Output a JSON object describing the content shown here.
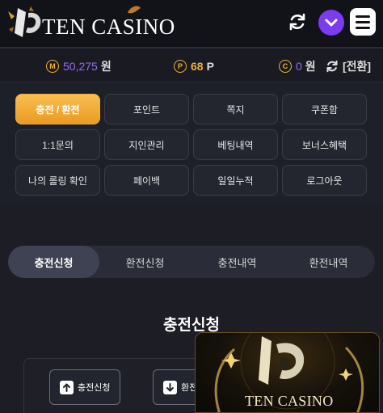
{
  "header": {
    "logo_text": "TEN CASINO",
    "refresh_icon": "refresh-icon",
    "dropdown_icon": "chevron-down-icon",
    "menu_icon": "hamburger-menu-icon",
    "accent": "#7b3bf0"
  },
  "balance": {
    "money": {
      "badge": "M",
      "value": "50,275",
      "unit": "원"
    },
    "point": {
      "badge": "P",
      "value": "68",
      "unit": "P"
    },
    "casino": {
      "badge": "C",
      "value": "0",
      "unit": "원"
    },
    "convert_label": "[전환]"
  },
  "menu": {
    "items": [
      {
        "label": "충전 / 환전",
        "active": true
      },
      {
        "label": "포인트"
      },
      {
        "label": "쪽지"
      },
      {
        "label": "쿠폰함"
      },
      {
        "label": "1:1문의"
      },
      {
        "label": "지인관리"
      },
      {
        "label": "베팅내역"
      },
      {
        "label": "보너스혜택"
      },
      {
        "label": "나의 롤링 확인"
      },
      {
        "label": "페이백"
      },
      {
        "label": "일일누적"
      },
      {
        "label": "로그아웃"
      }
    ]
  },
  "tabs": [
    {
      "label": "충전신청",
      "active": true
    },
    {
      "label": "환전신청"
    },
    {
      "label": "충전내역"
    },
    {
      "label": "환전내역"
    }
  ],
  "section": {
    "title": "충전신청",
    "buttons": [
      {
        "label": "충전신청",
        "icon": "deposit-icon"
      },
      {
        "label": "환전신청",
        "icon": "withdraw-icon"
      }
    ]
  },
  "promo": {
    "text": "TEN CASINO"
  },
  "colors": {
    "gold": "#f0b232",
    "active_button": "#ec9a21",
    "background": "#1e2029"
  }
}
